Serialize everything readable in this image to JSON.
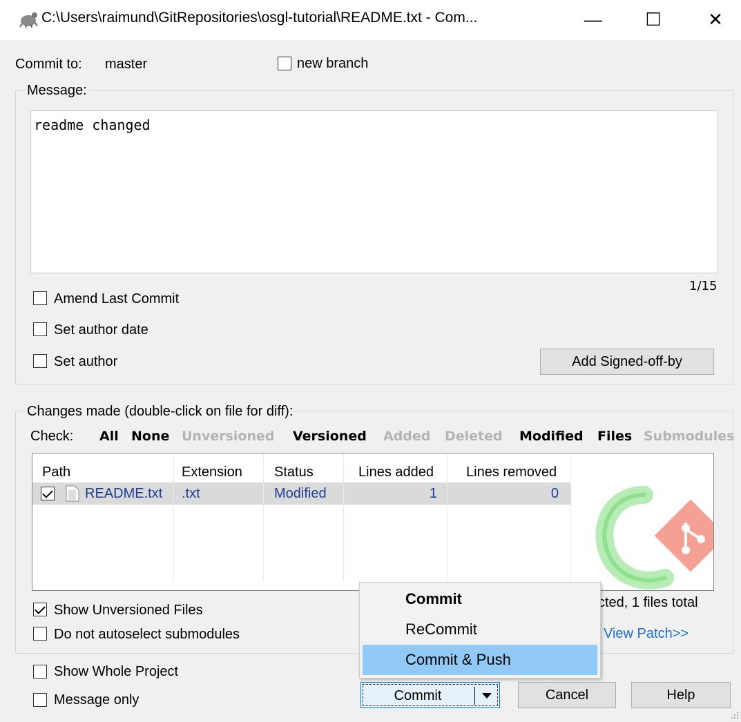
{
  "window": {
    "title": "C:\\Users\\raimund\\GitRepositories\\osgl-tutorial\\README.txt - Com...",
    "minimize": "—",
    "maximize": "☐",
    "close": "✕"
  },
  "commit_to": {
    "label": "Commit to:",
    "branch": "master",
    "new_branch_label": "new branch",
    "new_branch_checked": false
  },
  "message": {
    "legend": "Message:",
    "text": "readme changed",
    "counter": "1/15",
    "amend_label": "Amend Last Commit",
    "set_author_date_label": "Set author date",
    "set_author_label": "Set author",
    "signed_off_button": "Add Signed-off-by"
  },
  "changes": {
    "legend": "Changes made (double-click on file for diff):",
    "check_label": "Check:",
    "filters": [
      {
        "label": "All",
        "enabled": true
      },
      {
        "label": "None",
        "enabled": true
      },
      {
        "label": "Unversioned",
        "enabled": false
      },
      {
        "label": "Versioned",
        "enabled": true
      },
      {
        "label": "Added",
        "enabled": false
      },
      {
        "label": "Deleted",
        "enabled": false
      },
      {
        "label": "Modified",
        "enabled": true
      },
      {
        "label": "Files",
        "enabled": true
      },
      {
        "label": "Submodules",
        "enabled": false
      }
    ],
    "columns": [
      "Path",
      "Extension",
      "Status",
      "Lines added",
      "Lines removed"
    ],
    "rows": [
      {
        "checked": true,
        "path": "README.txt",
        "extension": ".txt",
        "status": "Modified",
        "lines_added": "1",
        "lines_removed": "0"
      }
    ],
    "summary": "cted, 1 files total",
    "view_patch": "View Patch>>",
    "show_unversioned_label": "Show Unversioned Files",
    "show_unversioned_checked": true,
    "no_autoselect_label": "Do not autoselect submodules"
  },
  "bottom": {
    "show_whole_project_label": "Show Whole Project",
    "message_only_label": "Message only",
    "commit_button": "Commit",
    "cancel_button": "Cancel",
    "help_button": "Help"
  },
  "dropdown_menu": {
    "items": [
      {
        "label": "Commit",
        "bold": true,
        "highlighted": false
      },
      {
        "label": "ReCommit",
        "bold": false,
        "highlighted": false
      },
      {
        "label": "Commit & Push",
        "bold": false,
        "highlighted": true
      }
    ]
  },
  "colors": {
    "accent_selection": "#91c9f7",
    "link_blue": "#1c3f94",
    "disabled_gray": "#b4b4b4",
    "logo_green": "#9be09b",
    "logo_red": "#f08070"
  }
}
